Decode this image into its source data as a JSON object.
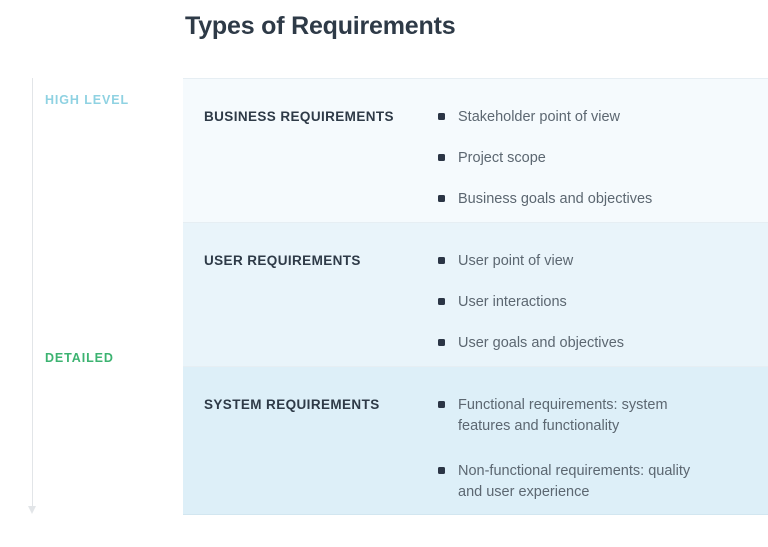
{
  "page": {
    "title": "Types of Requirements"
  },
  "axis": {
    "top_label": "HIGH LEVEL",
    "bottom_label": "DETAILED",
    "top_label_color": "#8fd2e2",
    "bottom_label_color": "#3cb371",
    "line_color": "#e2e5e8",
    "direction": "downward-arrow"
  },
  "rows": [
    {
      "title": "BUSINESS REQUIREMENTS",
      "background": "#f5fafd",
      "bullets": [
        "Stakeholder point of view",
        "Project scope",
        "Business goals and objectives"
      ]
    },
    {
      "title": "USER REQUIREMENTS",
      "background": "#e9f4fa",
      "bullets": [
        "User point of view",
        "User interactions",
        "User goals and objectives"
      ]
    },
    {
      "title": "SYSTEM REQUIREMENTS",
      "background": "#ddeff8",
      "bullets": [
        "Functional requirements: system features and functionality",
        "Non-functional requirements: quality and user experience"
      ]
    }
  ],
  "theme": {
    "title_color": "#2e3a47",
    "heading_color": "#2e3a47",
    "body_text_color": "#5c6771",
    "bullet_marker_color": "#2b3545",
    "page_background": "#ffffff"
  }
}
